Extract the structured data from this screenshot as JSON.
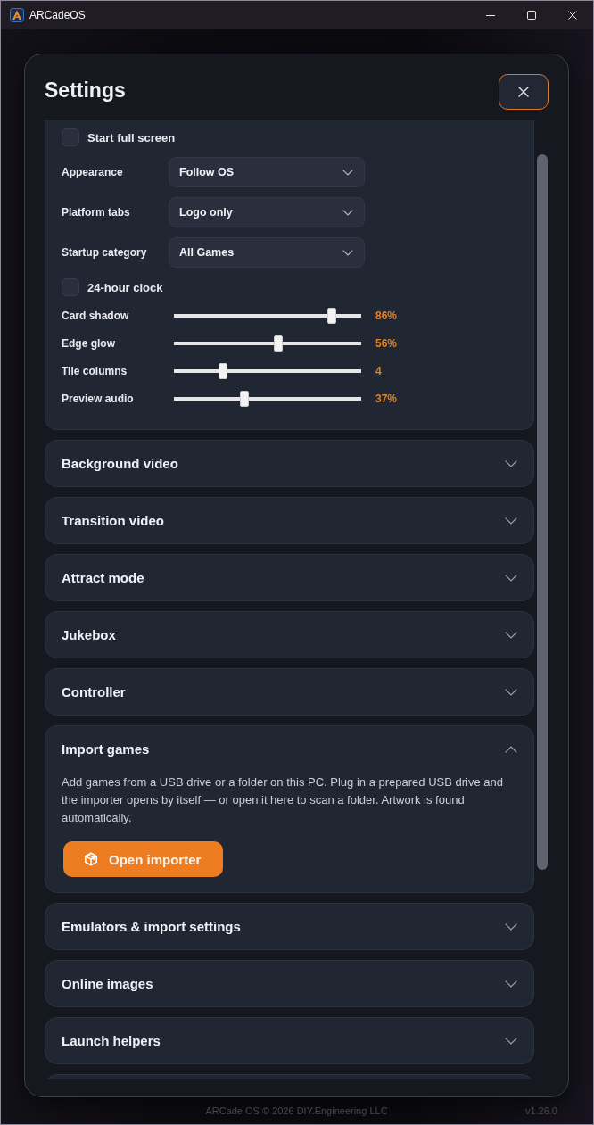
{
  "window": {
    "title": "ARCadeOS"
  },
  "dialog": {
    "title": "Settings"
  },
  "general": {
    "items": [
      {
        "kind": "checkbox",
        "label": "Start full screen",
        "checked": false
      },
      {
        "kind": "dropdown",
        "label": "Appearance",
        "value": "Follow OS"
      },
      {
        "kind": "dropdown",
        "label": "Platform tabs",
        "value": "Logo only"
      },
      {
        "kind": "dropdown",
        "label": "Startup category",
        "value": "All Games"
      },
      {
        "kind": "checkbox",
        "label": "24-hour clock",
        "checked": false
      },
      {
        "kind": "slider",
        "label": "Card shadow",
        "level": 0.86,
        "reading": "86%"
      },
      {
        "kind": "slider",
        "label": "Edge glow",
        "level": 0.56,
        "reading": "56%"
      },
      {
        "kind": "slider",
        "label": "Tile columns",
        "level": 0.25,
        "reading": "4"
      },
      {
        "kind": "slider",
        "label": "Preview audio",
        "level": 0.37,
        "reading": "37%"
      }
    ]
  },
  "sections": [
    {
      "title": "Background video",
      "expanded": false
    },
    {
      "title": "Transition video",
      "expanded": false
    },
    {
      "title": "Attract mode",
      "expanded": false
    },
    {
      "title": "Jukebox",
      "expanded": false
    },
    {
      "title": "Controller",
      "expanded": false
    },
    {
      "title": "Import games",
      "expanded": true,
      "description": "Add games from a USB drive or a folder on this PC. Plug in a prepared USB drive and the importer opens by itself — or open it here to scan a folder. Artwork is found automatically.",
      "button": "Open importer"
    },
    {
      "title": "Emulators & import settings",
      "expanded": false
    },
    {
      "title": "Online images",
      "expanded": false
    },
    {
      "title": "Launch helpers",
      "expanded": false
    }
  ],
  "footer": {
    "copyright": "ARCade OS © 2026 DIY.Engineering LLC",
    "version": "v1.26.0"
  }
}
